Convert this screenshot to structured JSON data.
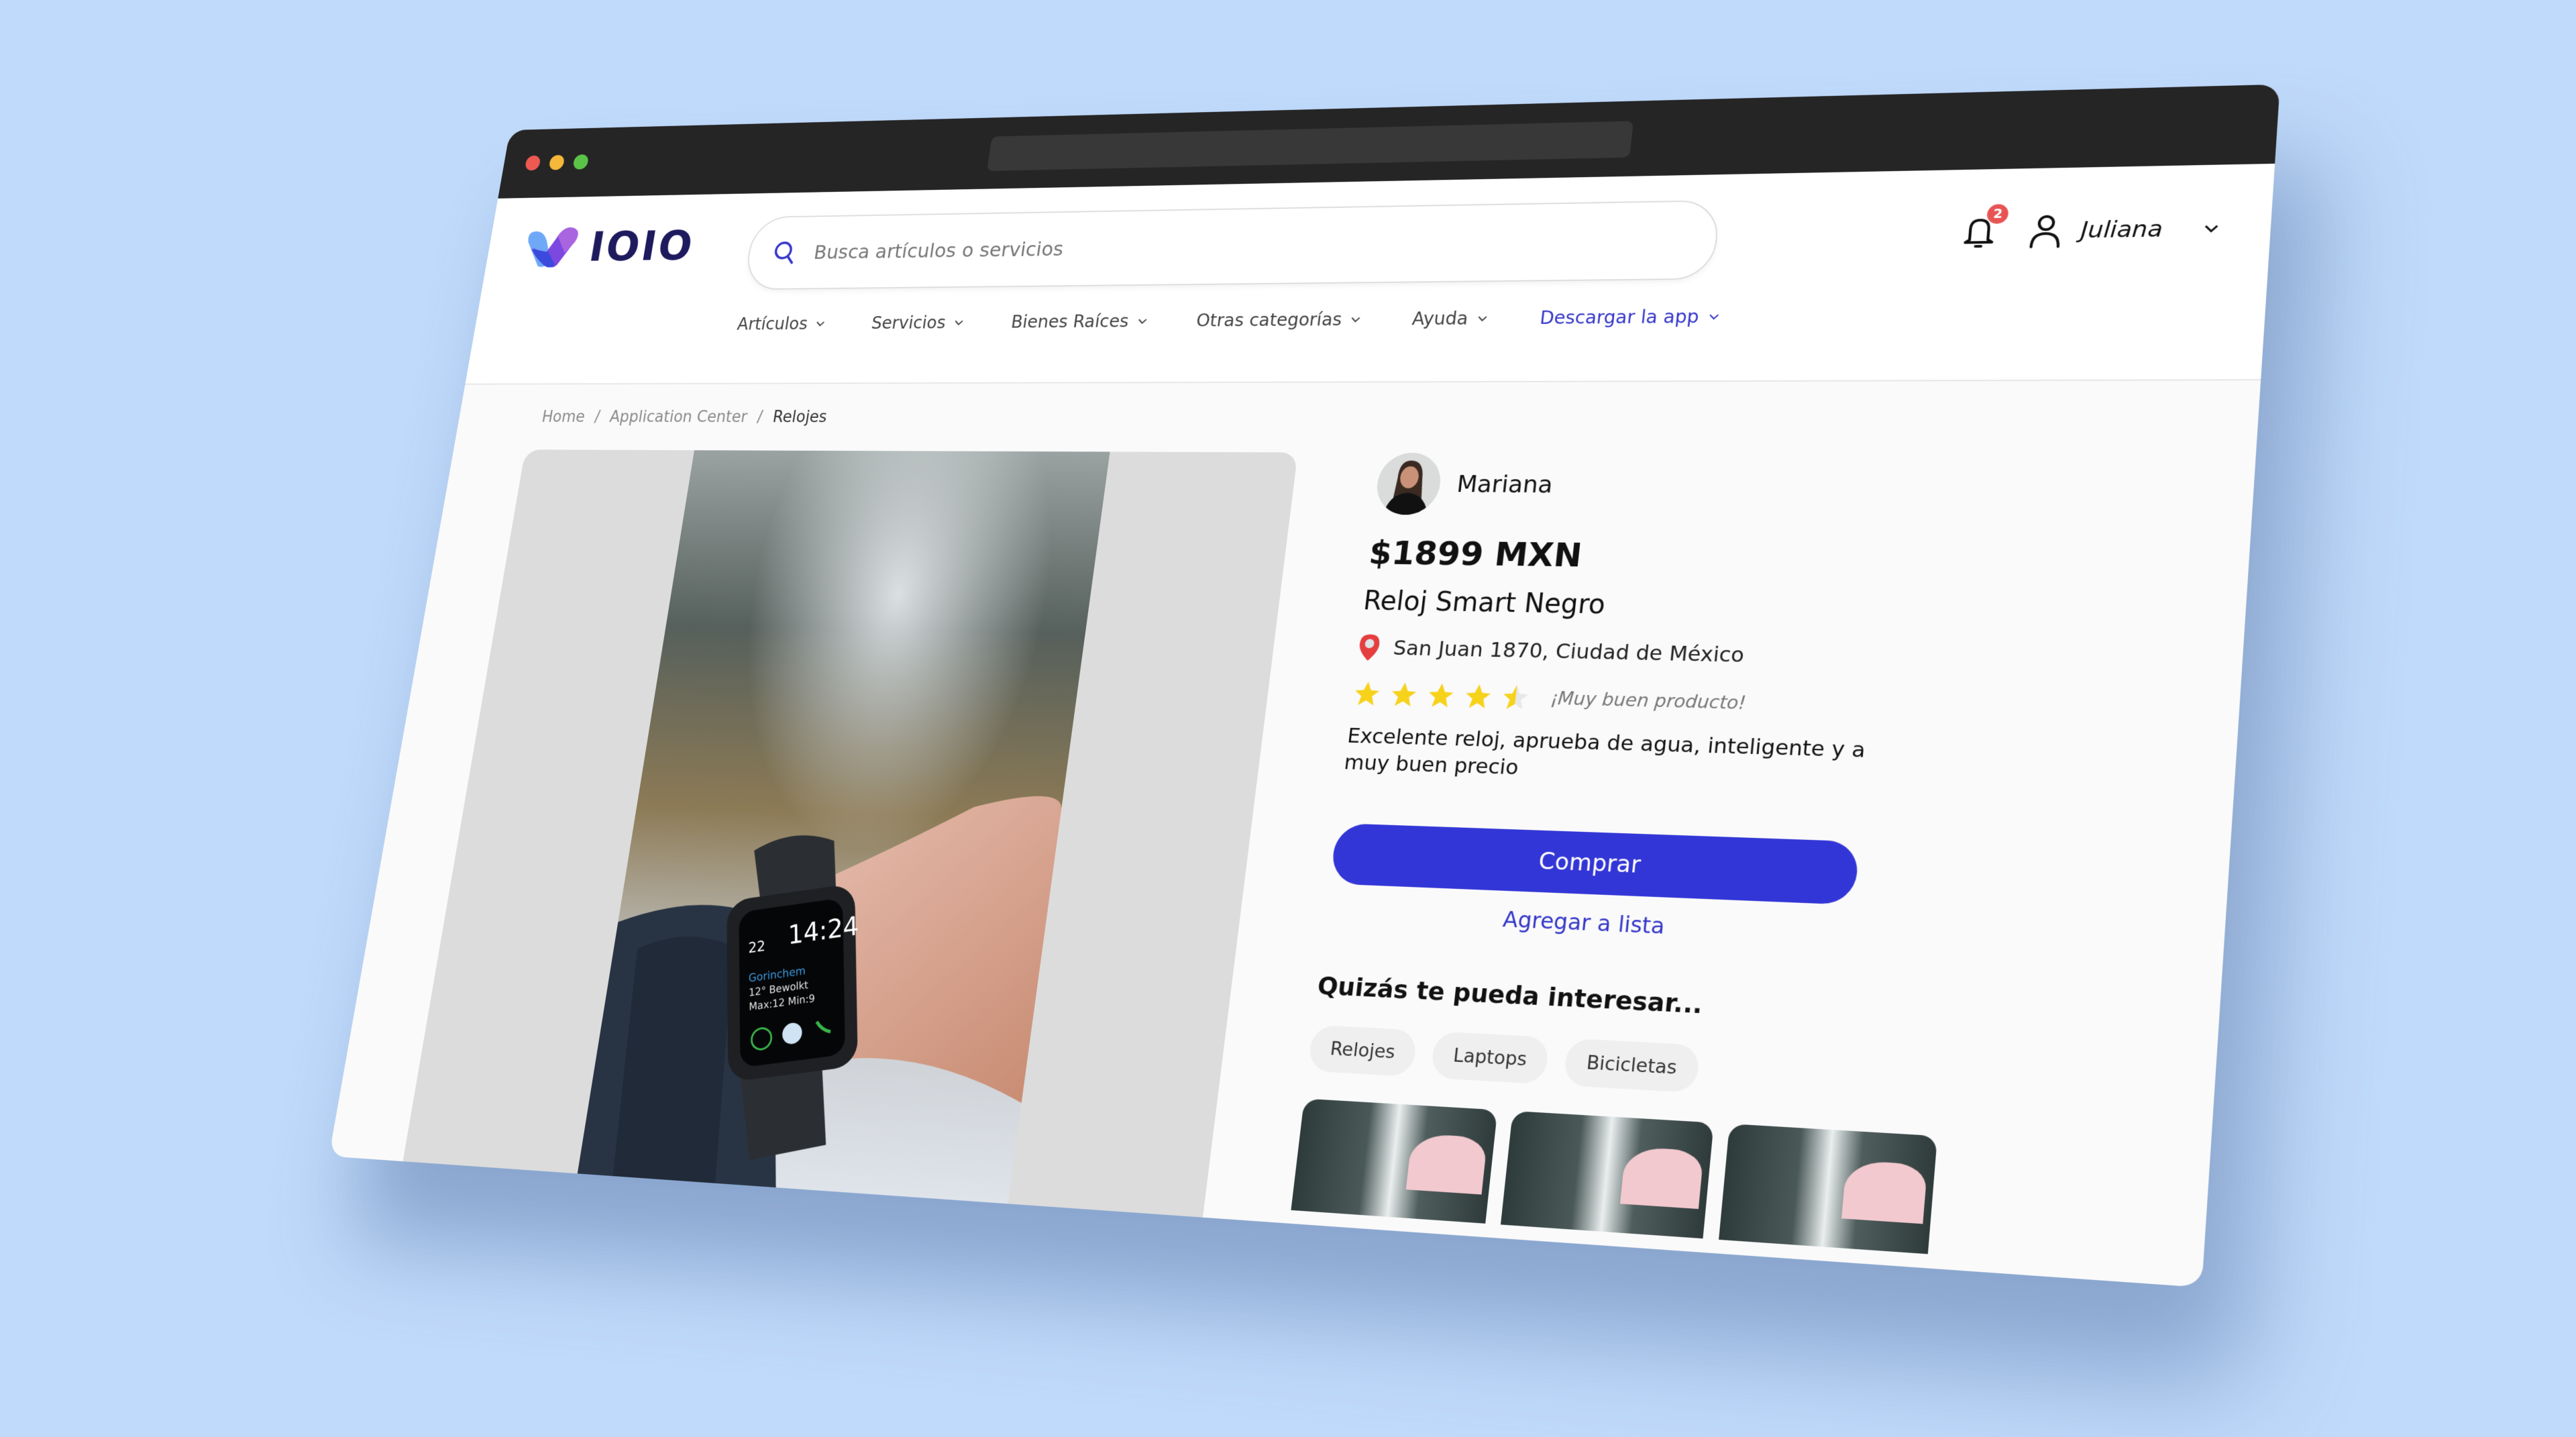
{
  "browser": {
    "window_controls": [
      "close",
      "minimize",
      "maximize"
    ]
  },
  "header": {
    "logo_text": "IOIO",
    "search": {
      "placeholder": "Busca artículos o servicios",
      "value": ""
    },
    "notifications": {
      "icon": "bell-icon",
      "count": "2"
    },
    "user": {
      "icon": "user-icon",
      "name": "Juliana"
    },
    "nav": [
      {
        "label": "Artículos",
        "accent": false
      },
      {
        "label": "Servicios",
        "accent": false
      },
      {
        "label": "Bienes Raíces",
        "accent": false
      },
      {
        "label": "Otras categorías",
        "accent": false
      },
      {
        "label": "Ayuda",
        "accent": false
      },
      {
        "label": "Descargar la app",
        "accent": true
      }
    ],
    "accent_color": "#3436c9"
  },
  "breadcrumb": {
    "items": [
      "Home",
      "Application Center",
      "Relojes"
    ],
    "separator": "/"
  },
  "product": {
    "image_alt": "Smartwatch en muñeca mostrando 14:24",
    "watch_face": {
      "time": "14:24",
      "date": "22",
      "city": "Gorinchem",
      "weather": "12° Bewolkt",
      "minmax": "Max:12 Min:9",
      "activity": "100"
    },
    "seller": {
      "name": "Mariana"
    },
    "price": "$1899 MXN",
    "title": "Reloj Smart Negro",
    "location": "San Juan 1870, Ciudad de México",
    "rating": {
      "value": 4.5,
      "max": 5,
      "review_title": "¡Muy buen producto!"
    },
    "description": "Excelente reloj, aprueba de agua, inteligente y a muy buen precio",
    "buy_label": "Comprar",
    "add_to_list_label": "Agregar a lista",
    "buy_color": "#3336d6"
  },
  "suggestions": {
    "title": "Quizás te pueda interesar...",
    "chips": [
      "Relojes",
      "Laptops",
      "Bicicletas"
    ],
    "thumbnail_count": 3
  }
}
